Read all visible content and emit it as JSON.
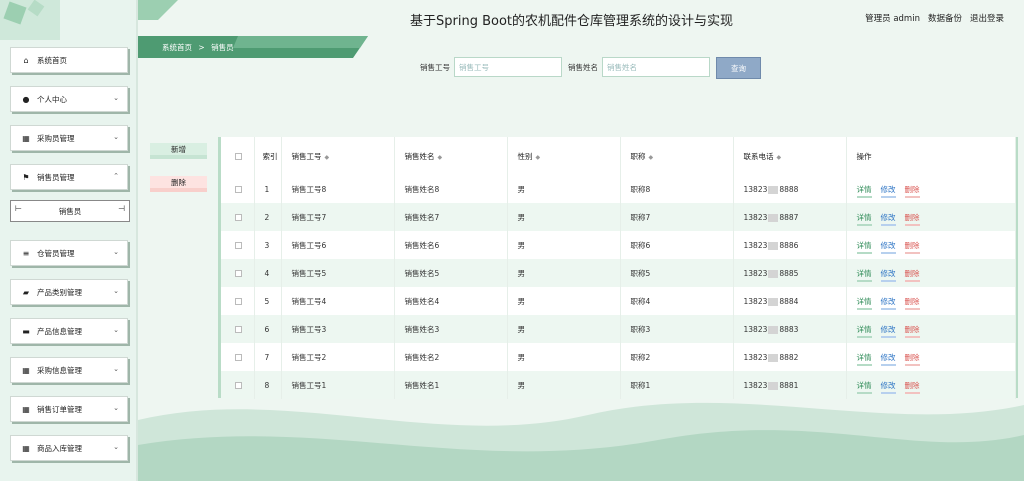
{
  "header": {
    "title": "基于Spring Boot的农机配件仓库管理系统的设计与实现",
    "admin": "管理员 admin",
    "backup": "数据备份",
    "logout": "退出登录"
  },
  "breadcrumb": {
    "home": "系统首页",
    "sep": ">",
    "current": "销售员"
  },
  "sidebar": {
    "items": [
      {
        "label": "系统首页",
        "icon": "home-icon",
        "glyph": "⌂",
        "chevron": ""
      },
      {
        "label": "个人中心",
        "icon": "user-icon",
        "glyph": "●",
        "chevron": "⌄"
      },
      {
        "label": "采购员管理",
        "icon": "grid-icon",
        "glyph": "▦",
        "chevron": "⌄"
      },
      {
        "label": "销售员管理",
        "icon": "flag-icon",
        "glyph": "⚑",
        "chevron": "⌃"
      },
      {
        "label": "仓管员管理",
        "icon": "list-icon",
        "glyph": "≡",
        "chevron": "⌄"
      },
      {
        "label": "产品类别管理",
        "icon": "folder-icon",
        "glyph": "▰",
        "chevron": "⌄"
      },
      {
        "label": "产品信息管理",
        "icon": "monitor-icon",
        "glyph": "▬",
        "chevron": "⌄"
      },
      {
        "label": "采购信息管理",
        "icon": "grid-icon",
        "glyph": "▦",
        "chevron": "⌄"
      },
      {
        "label": "销售订单管理",
        "icon": "grid-icon",
        "glyph": "▦",
        "chevron": "⌄"
      },
      {
        "label": "商品入库管理",
        "icon": "grid-icon",
        "glyph": "▦",
        "chevron": "⌄"
      }
    ],
    "submenu": "销售员"
  },
  "search": {
    "id_label": "销售工号",
    "id_placeholder": "销售工号",
    "name_label": "销售姓名",
    "name_placeholder": "销售姓名",
    "button": "查询"
  },
  "actions": {
    "add": "新增",
    "delete": "删除"
  },
  "table": {
    "headers": {
      "index": "索引",
      "id": "销售工号",
      "name": "销售姓名",
      "gender": "性别",
      "title": "职称",
      "phone": "联系电话",
      "ops": "操作"
    },
    "op_labels": {
      "detail": "详情",
      "edit": "修改",
      "delete": "删除"
    },
    "rows": [
      {
        "index": "1",
        "id": "销售工号8",
        "name": "销售姓名8",
        "gender": "男",
        "title": "职称8",
        "phone_a": "13823",
        "phone_b": "8888"
      },
      {
        "index": "2",
        "id": "销售工号7",
        "name": "销售姓名7",
        "gender": "男",
        "title": "职称7",
        "phone_a": "13823",
        "phone_b": "8887"
      },
      {
        "index": "3",
        "id": "销售工号6",
        "name": "销售姓名6",
        "gender": "男",
        "title": "职称6",
        "phone_a": "13823",
        "phone_b": "8886"
      },
      {
        "index": "4",
        "id": "销售工号5",
        "name": "销售姓名5",
        "gender": "男",
        "title": "职称5",
        "phone_a": "13823",
        "phone_b": "8885"
      },
      {
        "index": "5",
        "id": "销售工号4",
        "name": "销售姓名4",
        "gender": "男",
        "title": "职称4",
        "phone_a": "13823",
        "phone_b": "8884"
      },
      {
        "index": "6",
        "id": "销售工号3",
        "name": "销售姓名3",
        "gender": "男",
        "title": "职称3",
        "phone_a": "13823",
        "phone_b": "8883"
      },
      {
        "index": "7",
        "id": "销售工号2",
        "name": "销售姓名2",
        "gender": "男",
        "title": "职称2",
        "phone_a": "13823",
        "phone_b": "8882"
      },
      {
        "index": "8",
        "id": "销售工号1",
        "name": "销售姓名1",
        "gender": "男",
        "title": "职称1",
        "phone_a": "13823",
        "phone_b": "8881"
      }
    ]
  },
  "colors": {
    "accent": "#5aa47c",
    "accent_light": "#d9efe2",
    "danger": "#d9534f",
    "link": "#2b73c4"
  }
}
